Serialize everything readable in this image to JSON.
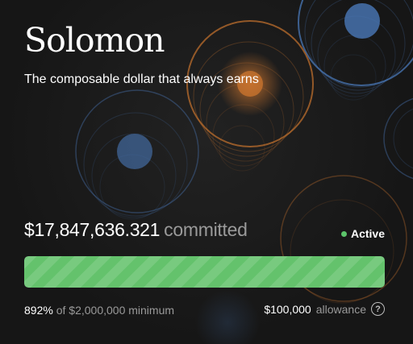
{
  "hero": {
    "title": "Solomon",
    "subtitle": "The composable dollar that always earns"
  },
  "stats": {
    "committed_amount": "$17,847,636.321",
    "committed_suffix": "committed",
    "status": "Active",
    "status_color": "#5cc46a",
    "progress_fraction": 1.0,
    "progress_color": "#64c26c",
    "percent": "892%",
    "of_label": "of",
    "minimum_amount": "$2,000,000",
    "minimum_label": "minimum",
    "allowance_amount": "$100,000",
    "allowance_label": "allowance",
    "help_icon": "question-circle-icon"
  },
  "theme": {
    "background": "#161616",
    "orb_blue": "#4a78b8",
    "orb_orange": "#c8732e"
  }
}
